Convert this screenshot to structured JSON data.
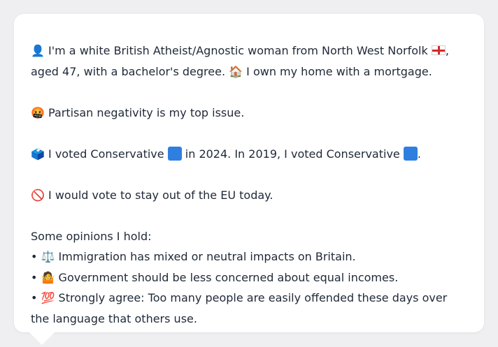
{
  "persona": {
    "line1": {
      "icon": "👤",
      "text_a": " I'm a white British Atheist/Agnostic woman from North West Norfolk ",
      "flag": "england-flag",
      "text_b": ","
    },
    "line2": {
      "text_a": "aged 47, with a bachelor's degree. ",
      "icon": "🏠",
      "text_b": " I own my home with a mortgage."
    },
    "issue": {
      "icon": "🤬",
      "text": " Partisan negativity is my top issue."
    },
    "vote": {
      "icon": "🗳️",
      "text_a": " I voted Conservative ",
      "text_b": " in 2024. In 2019, I voted Conservative ",
      "text_c": ".",
      "party_color": "#2f7fe0"
    },
    "eu": {
      "icon": "🚫",
      "text": " I would vote to stay out of the EU today."
    },
    "opinions_heading": "Some opinions I hold:",
    "opinions": [
      {
        "bullet": "• ",
        "icon": "⚖️",
        "text": " Immigration has mixed or neutral impacts on Britain."
      },
      {
        "bullet": "• ",
        "icon": "🤷",
        "text": " Government should be less concerned about equal incomes."
      },
      {
        "bullet": "• ",
        "icon": "💯",
        "text": " Strongly agree: Too many people are easily offended these days over the language that others use."
      }
    ]
  }
}
